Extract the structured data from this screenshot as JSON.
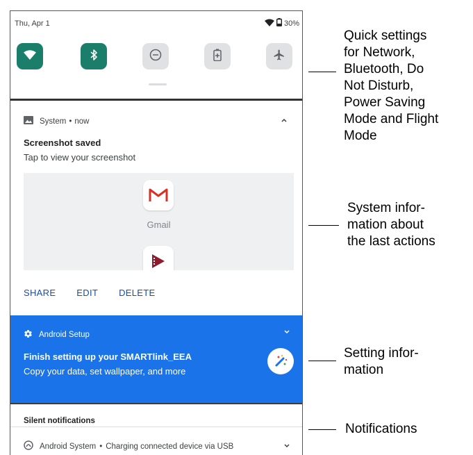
{
  "status_bar": {
    "date": "Thu, Apr 1",
    "battery": "30%"
  },
  "quick_tiles": [
    {
      "name": "wifi",
      "state": "on"
    },
    {
      "name": "bluetooth",
      "state": "on"
    },
    {
      "name": "do-not-disturb",
      "state": "off"
    },
    {
      "name": "battery-saver",
      "state": "off"
    },
    {
      "name": "airplane-mode",
      "state": "off"
    }
  ],
  "system_notification": {
    "app": "System",
    "time": "now",
    "separator": "•",
    "title": "Screenshot saved",
    "text": "Tap to view your screenshot",
    "preview": {
      "app_label": "Gmail"
    },
    "actions": [
      "SHARE",
      "EDIT",
      "DELETE"
    ]
  },
  "setup_notification": {
    "app": "Android Setup",
    "title": "Finish setting up your SMARTlink_EEA",
    "text": "Copy your data, set wallpaper, and more"
  },
  "silent": {
    "header": "Silent notifications",
    "row": {
      "app": "Android System",
      "separator": "•",
      "text": "Charging connected device via USB"
    }
  },
  "callouts": {
    "quick_settings": [
      "Quick settings",
      "for Network,",
      "Bluetooth, Do",
      "Not Disturb,",
      "Power Saving",
      "Mode and Flight",
      "Mode"
    ],
    "system_info": [
      "System infor-",
      "mation about",
      "the last actions"
    ],
    "setting_info": [
      "Setting infor-",
      "mation"
    ],
    "notifications": [
      "Notifications"
    ]
  },
  "colors": {
    "tile_on": "#1a7e6a",
    "tile_off": "#dfe1e3",
    "setup_card": "#1a73e8",
    "action_text": "#174ea6"
  }
}
